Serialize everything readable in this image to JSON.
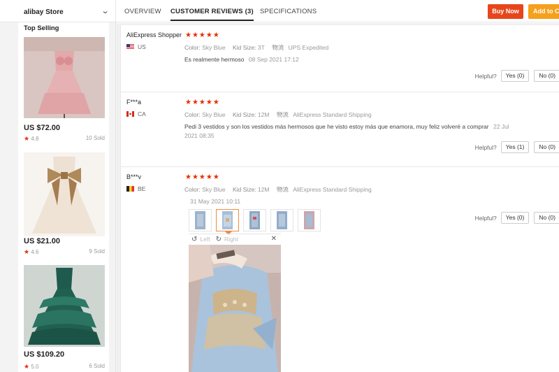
{
  "store": {
    "name": "alibay Store",
    "chevron_icon": "chevron-down-icon"
  },
  "sidebar": {
    "heading": "Top Selling",
    "products": [
      {
        "price": "US $72.00",
        "rating": "4.8",
        "sold": "10 Sold"
      },
      {
        "price": "US $21.00",
        "rating": "4.6",
        "sold": "9 Sold"
      },
      {
        "price": "US $109.20",
        "rating": "5.0",
        "sold": "6 Sold"
      }
    ]
  },
  "tabs": [
    {
      "label": "OVERVIEW"
    },
    {
      "label": "CUSTOMER REVIEWS (3)"
    },
    {
      "label": "SPECIFICATIONS"
    }
  ],
  "actions": {
    "buy_now": "Buy Now",
    "add_to_cart": "Add to Cart"
  },
  "colors": {
    "accent_red": "#e7461b",
    "accent_orange": "#f6a01b",
    "star": "#e62e04"
  },
  "reviews": [
    {
      "reviewer": "AliExpress Shopper",
      "country": "US",
      "stars": "★★★★★",
      "color_label": "Color:",
      "color": "Sky Blue",
      "size_label": "Kid Size:",
      "size": "3T",
      "ship_label": "物流",
      "shipping": "UPS Expedited",
      "text": "Es realmente hermoso",
      "date": "08 Sep 2021 17:12",
      "helpful_label": "Helpful?",
      "yes": "Yes (0)",
      "no": "No (0)"
    },
    {
      "reviewer": "F***a",
      "country": "CA",
      "stars": "★★★★★",
      "color_label": "Color:",
      "color": "Sky Blue",
      "size_label": "Kid Size:",
      "size": "12M",
      "ship_label": "物流",
      "shipping": "AliExpress Standard Shipping",
      "text": "Pedi 3 vestidos y son los vestidos más hermosos que he visto estoy más que enamora, muy feliz volveré a comprar",
      "date": "22 Jul 2021 08:35",
      "helpful_label": "Helpful?",
      "yes": "Yes (1)",
      "no": "No (0)"
    },
    {
      "reviewer": "B***v",
      "country": "BE",
      "stars": "★★★★★",
      "color_label": "Color:",
      "color": "Sky Blue",
      "size_label": "Kid Size:",
      "size": "12M",
      "ship_label": "物流",
      "shipping": "AliExpress Standard Shipping",
      "date": "31 May 2021 10:11",
      "helpful_label": "Helpful?",
      "yes": "Yes (0)",
      "no": "No (0)",
      "viewer": {
        "left": "Left",
        "right": "Right",
        "close": "✕"
      }
    }
  ]
}
